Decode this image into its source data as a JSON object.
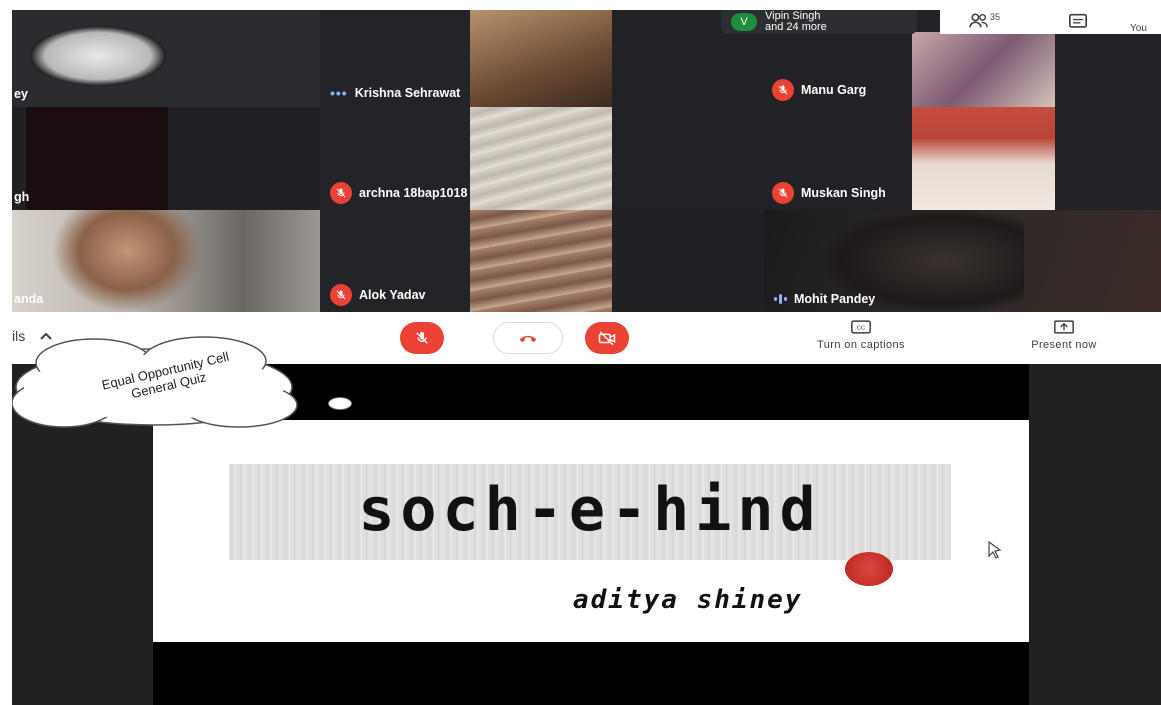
{
  "meeting": {
    "chip_avatar_letter": "V",
    "chip_line1": "Vipin Singh",
    "chip_line2": "and 24 more",
    "people_count": "35",
    "you_label": "You"
  },
  "participants": [
    {
      "name": "ey",
      "state": "none"
    },
    {
      "name": "Krishna Sehrawat",
      "state": "dots"
    },
    {
      "name": "Manu Garg",
      "state": "muted"
    },
    {
      "name": "gh",
      "state": "none"
    },
    {
      "name": "archna 18bap1018",
      "state": "muted"
    },
    {
      "name": "Muskan Singh",
      "state": "muted"
    },
    {
      "name": "anda",
      "state": "none"
    },
    {
      "name": "Alok Yadav",
      "state": "muted"
    },
    {
      "name": "Mohit Pandey",
      "state": "speaking"
    }
  ],
  "controls": {
    "details_label": "ils",
    "captions_label": "Turn on captions",
    "present_label": "Present now"
  },
  "overlay": {
    "cloud_line1": "Equal Opportunity Cell",
    "cloud_line2": "General Quiz"
  },
  "slide": {
    "title": "soch-e-hind",
    "subtitle": "aditya shiney"
  },
  "colors": {
    "danger": "#ea4335",
    "grid_bg": "#202124",
    "speaking": "#8ab4f8"
  }
}
